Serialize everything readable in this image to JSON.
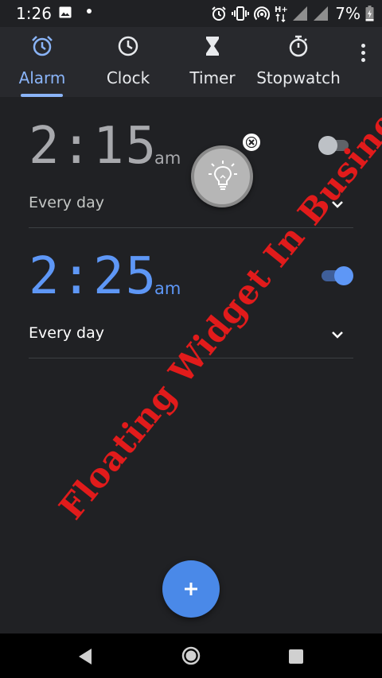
{
  "status_bar": {
    "time": "1:26",
    "battery_percent": "7%",
    "icons": [
      "image-icon",
      "dot-icon",
      "alarm-icon",
      "vibrate-icon",
      "hotspot-icon",
      "data-hplus-icon",
      "signal-icon",
      "signal-icon",
      "battery-charging-icon"
    ]
  },
  "tabs": [
    {
      "label": "Alarm",
      "icon": "alarm-clock-icon",
      "active": true
    },
    {
      "label": "Clock",
      "icon": "clock-icon",
      "active": false
    },
    {
      "label": "Timer",
      "icon": "hourglass-icon",
      "active": false
    },
    {
      "label": "Stopwatch",
      "icon": "stopwatch-icon",
      "active": false
    }
  ],
  "alarms": [
    {
      "time": "2:15",
      "ampm": "am",
      "repeat": "Every day",
      "enabled": false
    },
    {
      "time": "2:25",
      "ampm": "am",
      "repeat": "Every day",
      "enabled": true
    }
  ],
  "watermark": "Floating Widget In Business",
  "colors": {
    "accent": "#8ab4f8",
    "active_time": "#5e97f6",
    "inactive_time": "#a8a9ad",
    "fab": "#4a89e8",
    "watermark": "#e11b1b",
    "background": "#202124"
  }
}
